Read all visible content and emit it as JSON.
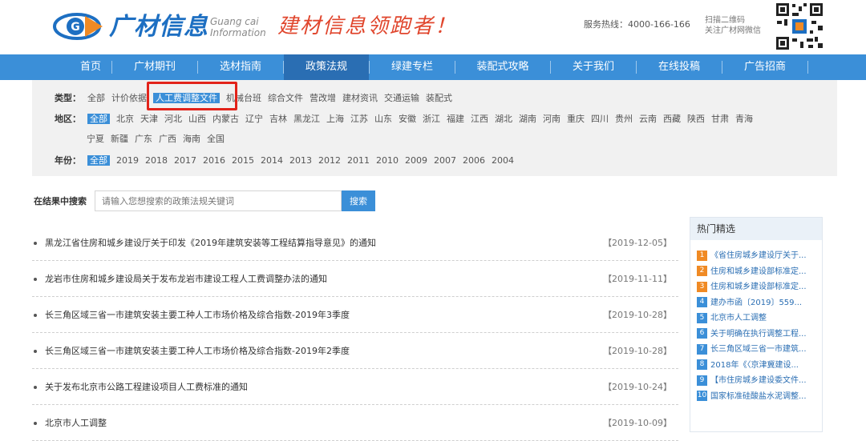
{
  "header": {
    "logo_cn": "广材信息",
    "logo_en_line1": "Guang cai",
    "logo_en_line2": "Information",
    "slogan": "建材信息领跑者！",
    "hotline": "服务热线：4000-166-166",
    "qr_line1": "扫描二维码",
    "qr_line2": "关注广材网微信",
    "logo_letter": "G"
  },
  "nav": {
    "items": [
      {
        "label": "首页"
      },
      {
        "label": "广材期刊"
      },
      {
        "label": "选材指南"
      },
      {
        "label": "政策法规",
        "active": true
      },
      {
        "label": "绿建专栏"
      },
      {
        "label": "装配式攻略"
      },
      {
        "label": "关于我们"
      },
      {
        "label": "在线投稿"
      },
      {
        "label": "广告招商"
      }
    ]
  },
  "filters": {
    "type_label": "类型：",
    "types": [
      "全部",
      "计价依据",
      "人工费调整文件",
      "机械台班",
      "综合文件",
      "营改增",
      "建材资讯",
      "交通运输",
      "装配式"
    ],
    "type_selected": "人工费调整文件",
    "region_label": "地区：",
    "regions_row1": [
      "全部",
      "北京",
      "天津",
      "河北",
      "山西",
      "内蒙古",
      "辽宁",
      "吉林",
      "黑龙江",
      "上海",
      "江苏",
      "山东",
      "安徽",
      "浙江",
      "福建",
      "江西",
      "湖北",
      "湖南",
      "河南",
      "重庆",
      "四川",
      "贵州",
      "云南",
      "西藏",
      "陕西",
      "甘肃",
      "青海"
    ],
    "regions_row2": [
      "宁夏",
      "新疆",
      "广东",
      "广西",
      "海南",
      "全国"
    ],
    "region_selected": "全部",
    "year_label": "年份：",
    "years": [
      "全部",
      "2019",
      "2018",
      "2017",
      "2016",
      "2015",
      "2014",
      "2013",
      "2012",
      "2011",
      "2010",
      "2009",
      "2007",
      "2006",
      "2004"
    ],
    "year_selected": "全部"
  },
  "search": {
    "label": "在结果中搜索",
    "placeholder": "请输入您想搜索的政策法规关键词",
    "button": "搜索"
  },
  "results": [
    {
      "title": "黑龙江省住房和城乡建设厅关于印发《2019年建筑安装等工程结算指导意见》的通知",
      "date": "【2019-12-05】"
    },
    {
      "title": "龙岩市住房和城乡建设局关于发布龙岩市建设工程人工费调整办法的通知",
      "date": "【2019-11-11】"
    },
    {
      "title": "长三角区域三省一市建筑安装主要工种人工市场价格及综合指数-2019年3季度",
      "date": "【2019-10-28】"
    },
    {
      "title": "长三角区域三省一市建筑安装主要工种人工市场价格及综合指数-2019年2季度",
      "date": "【2019-10-28】"
    },
    {
      "title": "关于发布北京市公路工程建设项目人工费标准的通知",
      "date": "【2019-10-24】"
    },
    {
      "title": "北京市人工调整",
      "date": "【2019-10-09】"
    }
  ],
  "hot": {
    "title": "热门精选",
    "items": [
      {
        "num": "1",
        "text": "《省住房城乡建设厅关于..."
      },
      {
        "num": "2",
        "text": "住房和城乡建设部标准定..."
      },
      {
        "num": "3",
        "text": "住房和城乡建设部标准定..."
      },
      {
        "num": "4",
        "text": "建办市函〔2019〕559..."
      },
      {
        "num": "5",
        "text": "北京市人工调整"
      },
      {
        "num": "6",
        "text": "关于明确在执行调整工程..."
      },
      {
        "num": "7",
        "text": "长三角区域三省一市建筑..."
      },
      {
        "num": "8",
        "text": "2018年《〈京津冀建设..."
      },
      {
        "num": "9",
        "text": "【市住房城乡建设委文件..."
      },
      {
        "num": "10",
        "text": "国家标准硅酸盐水泥调整..."
      }
    ]
  },
  "colors": {
    "brand_blue": "#3b8fd8",
    "nav_active": "#2a6eb3",
    "highlight_red": "#e2231a",
    "hot_top3": "#f08a24",
    "hot_rest": "#3b8fd8"
  }
}
